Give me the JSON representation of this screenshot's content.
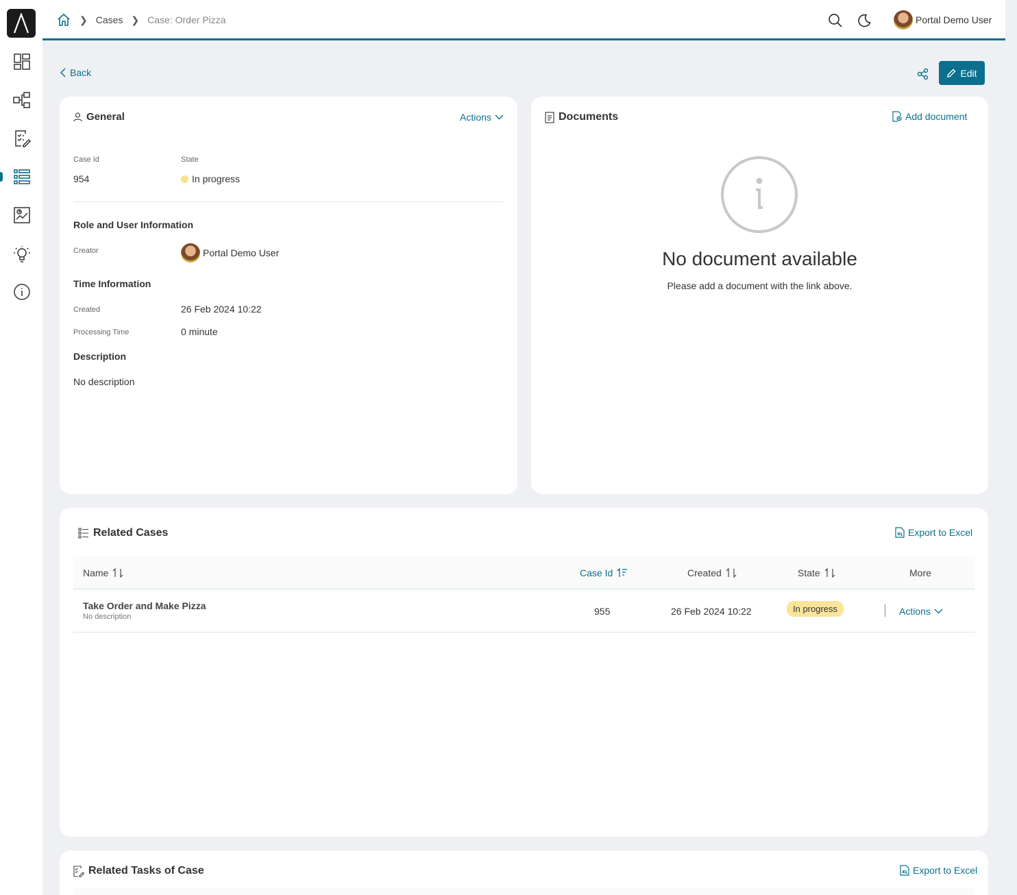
{
  "app": {
    "logo_icon": "portal-logo-icon",
    "accent": "#0b6f8d"
  },
  "sidebar": {
    "items": [
      {
        "name": "dashboard",
        "icon": "dashboard-icon"
      },
      {
        "name": "processes",
        "icon": "process-icon"
      },
      {
        "name": "tasks",
        "icon": "tasks-icon"
      },
      {
        "name": "cases",
        "icon": "cases-icon",
        "active": true
      },
      {
        "name": "statistics",
        "icon": "statistics-icon"
      },
      {
        "name": "ideas",
        "icon": "lightbulb-icon"
      },
      {
        "name": "about",
        "icon": "info-icon"
      }
    ]
  },
  "header": {
    "breadcrumb": {
      "home_icon": "home-icon",
      "cases": "Cases",
      "current": "Case: Order Pizza"
    },
    "user_name": "Portal Demo User"
  },
  "toolbar": {
    "back": "Back",
    "edit": "Edit"
  },
  "general": {
    "title": "General",
    "actions": "Actions",
    "case_id_label": "Case Id",
    "case_id": "954",
    "state_label": "State",
    "state": "In progress",
    "role_title": "Role and User Information",
    "creator_label": "Creator",
    "creator": "Portal Demo User",
    "time_title": "Time Information",
    "created_label": "Created",
    "created": "26 Feb 2024 10:22",
    "processing_label": "Processing Time",
    "processing": "0 minute",
    "description_title": "Description",
    "description": "No description"
  },
  "documents": {
    "title": "Documents",
    "add": "Add document",
    "empty_title": "No document available",
    "empty_sub": "Please add a document with the link above."
  },
  "related_cases": {
    "title": "Related Cases",
    "export": "Export to Excel",
    "columns": {
      "name": "Name",
      "case_id": "Case Id",
      "created": "Created",
      "state": "State",
      "more": "More"
    },
    "rows": [
      {
        "name": "Take Order and Make Pizza",
        "description": "No description",
        "case_id": "955",
        "created": "26 Feb 2024 10:22",
        "state": "In progress",
        "actions": "Actions"
      }
    ]
  },
  "related_tasks": {
    "title": "Related Tasks of Case",
    "export": "Export to Excel"
  }
}
